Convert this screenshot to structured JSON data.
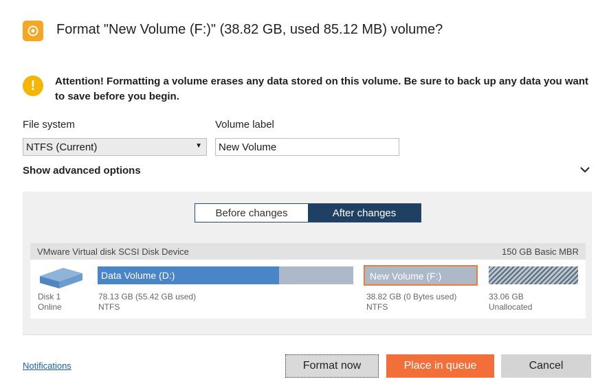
{
  "dialog": {
    "title": "Format \"New Volume (F:)\" (38.82 GB, used 85.12 MB) volume?",
    "warning": "Attention! Formatting a volume erases any data stored on this volume. Be sure to back up any data you want to save before you begin."
  },
  "form": {
    "file_system_label": "File system",
    "file_system_value": "NTFS (Current)",
    "volume_label_label": "Volume label",
    "volume_label_value": "New Volume",
    "advanced_label": "Show advanced options"
  },
  "view_toggle": {
    "before": "Before changes",
    "after": "After changes"
  },
  "disk": {
    "name": "VMware Virtual disk SCSI Disk Device",
    "info": "150 GB Basic MBR",
    "number": "Disk 1",
    "status": "Online",
    "partitions": [
      {
        "name": "Data Volume (D:)",
        "size": "78.13 GB (55.42 GB used)",
        "fs": "NTFS",
        "used_fraction": 0.71
      },
      {
        "name": "New Volume (F:)",
        "size": "38.82 GB (0 Bytes used)",
        "fs": "NTFS",
        "used_fraction": 0
      },
      {
        "name": "",
        "size": "33.06 GB",
        "fs": "Unallocated",
        "used_fraction": 0
      }
    ]
  },
  "footer": {
    "notifications": "Notifications",
    "format_now": "Format now",
    "place_in_queue": "Place in queue",
    "cancel": "Cancel"
  },
  "colors": {
    "accent_orange": "#f26f3a",
    "partition_blue": "#4a84c9",
    "toggle_active": "#1f3f63",
    "warning_yellow": "#f6b500"
  }
}
